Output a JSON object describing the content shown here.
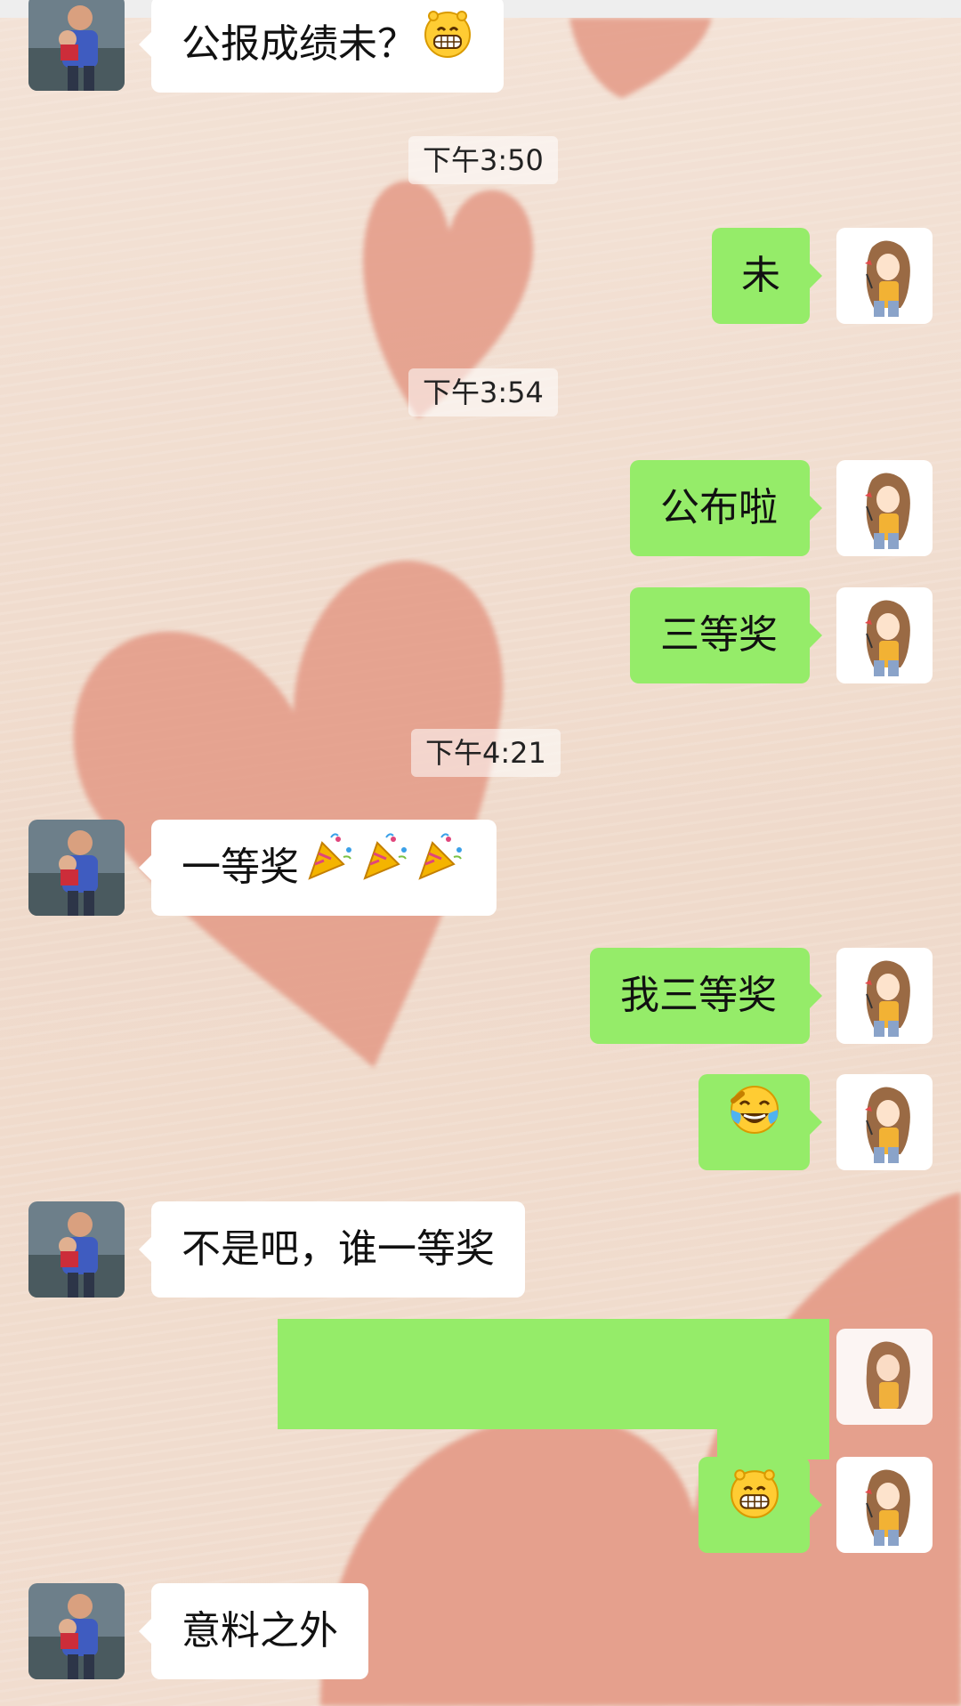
{
  "colors": {
    "incoming_bubble": "#ffffff",
    "outgoing_bubble": "#95ec69",
    "background": "#f0dccd",
    "heart": "#e49a86"
  },
  "chat": {
    "messages": [
      {
        "type": "incoming",
        "text": "公报成绩未？",
        "emoji": "grinning-face"
      },
      {
        "type": "timestamp",
        "text": "下午3:50"
      },
      {
        "type": "outgoing",
        "text": "未"
      },
      {
        "type": "timestamp",
        "text": "下午3:54"
      },
      {
        "type": "outgoing",
        "text": "公布啦"
      },
      {
        "type": "outgoing",
        "text": "三等奖"
      },
      {
        "type": "timestamp",
        "text": "下午4:21"
      },
      {
        "type": "incoming",
        "text": "一等奖",
        "emoji": "party-popper-x3"
      },
      {
        "type": "outgoing",
        "text": "我三等奖"
      },
      {
        "type": "outgoing",
        "text": "",
        "emoji": "rolling-on-floor-laughing"
      },
      {
        "type": "incoming",
        "text": "不是吧，谁一等奖"
      },
      {
        "type": "outgoing",
        "text": "",
        "redacted": true
      },
      {
        "type": "outgoing",
        "text": "",
        "emoji": "grinning-face"
      },
      {
        "type": "incoming",
        "text": "意料之外"
      }
    ]
  }
}
